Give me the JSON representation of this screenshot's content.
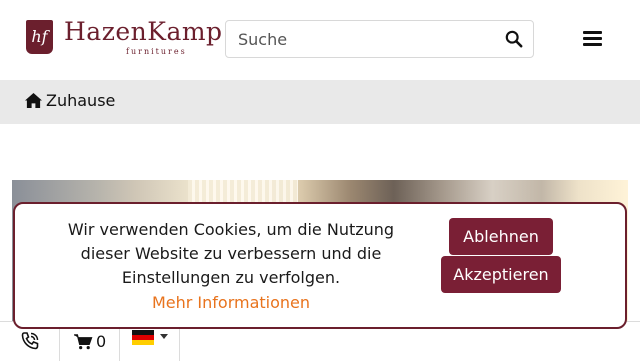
{
  "header": {
    "logo": {
      "mark": "hf",
      "name": "HazenKamp",
      "tagline": "furnitures"
    },
    "search": {
      "placeholder": "Suche",
      "value": ""
    },
    "icons": [
      "search-icon",
      "hamburger-menu-icon"
    ]
  },
  "breadcrumb": {
    "items": [
      {
        "label": "Zuhause",
        "icon": "home-icon"
      }
    ]
  },
  "cookie_banner": {
    "message": "Wir verwenden Cookies, um die Nutzung dieser Website zu verbessern und die Einstellungen zu verfolgen.",
    "more_info_link": "Mehr Informationen",
    "decline_label": "Ablehnen",
    "accept_label": "Akzeptieren"
  },
  "bottom_bar": {
    "cart_count": "0",
    "icons": [
      "phone-icon",
      "cart-icon",
      "germany-flag-icon",
      "caret-down-icon"
    ]
  },
  "colors": {
    "brand": "#6b1f2d",
    "button": "#7a1f35",
    "link": "#e8731d",
    "breadcrumb_bg": "#e9e9e9"
  }
}
